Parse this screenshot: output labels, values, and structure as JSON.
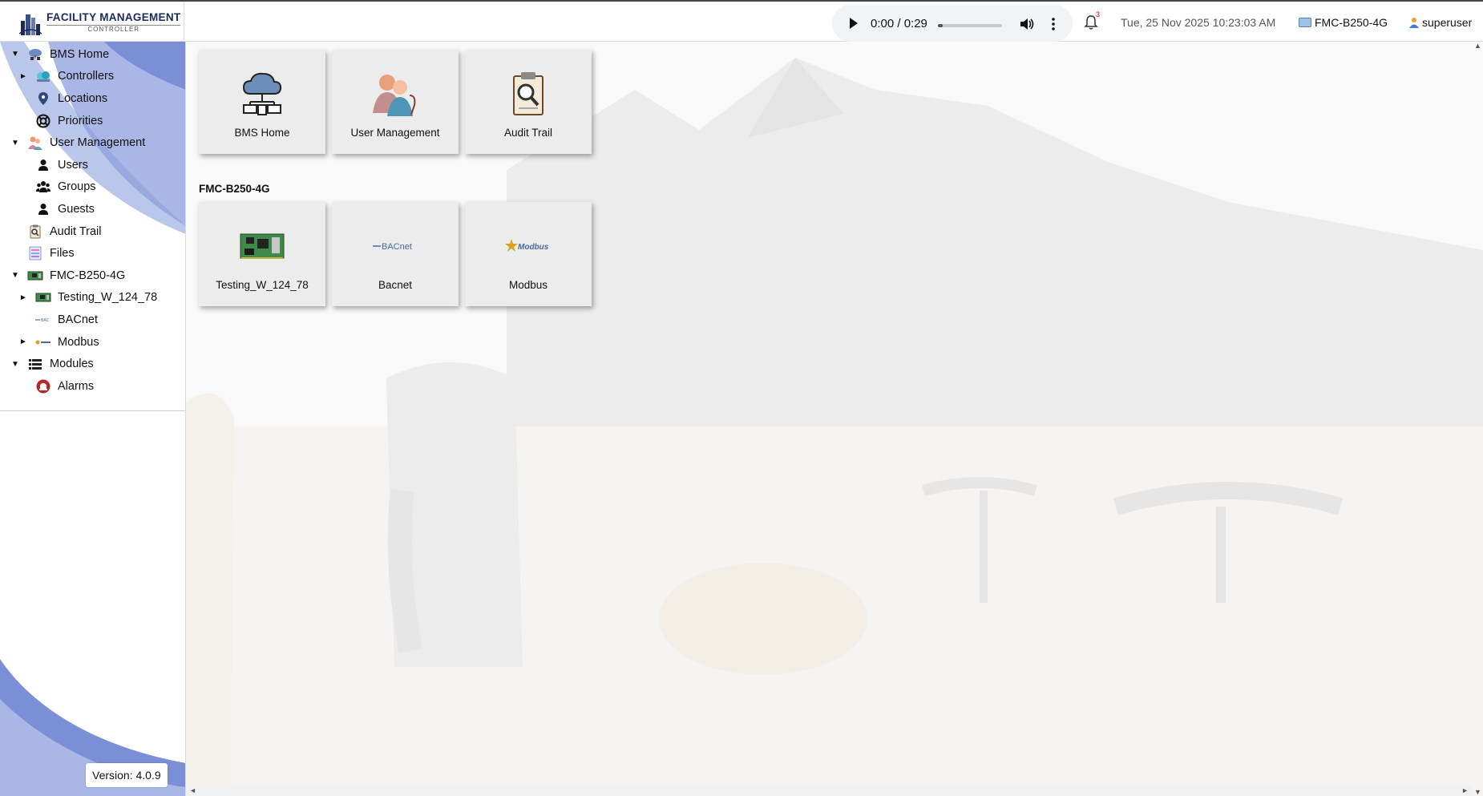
{
  "app": {
    "logo_main": "FACILITY MANAGEMENT",
    "logo_sub": "CONTROLLER"
  },
  "header": {
    "audio_time": "0:00 / 0:29",
    "audio_progress": 0.05,
    "notification_count": "3",
    "datetime": "Tue, 25 Nov 2025 10:23:03 AM",
    "controller": "FMC-B250-4G",
    "user": "superuser"
  },
  "sidebar": {
    "items": [
      {
        "label": "BMS Home",
        "caret": "▼",
        "level": 0,
        "icon": "cloud-network-icon"
      },
      {
        "label": "Controllers",
        "caret": "►",
        "level": 1,
        "icon": "controllers-icon"
      },
      {
        "label": "Locations",
        "caret": "",
        "level": 1,
        "icon": "location-pin-icon"
      },
      {
        "label": "Priorities",
        "caret": "",
        "level": 1,
        "icon": "lifebuoy-icon"
      },
      {
        "label": "User Management",
        "caret": "▼",
        "level": 0,
        "icon": "users-group-icon"
      },
      {
        "label": "Users",
        "caret": "",
        "level": 1,
        "icon": "user-icon"
      },
      {
        "label": "Groups",
        "caret": "",
        "level": 1,
        "icon": "group-icon"
      },
      {
        "label": "Guests",
        "caret": "",
        "level": 1,
        "icon": "guest-icon"
      },
      {
        "label": "Audit Trail",
        "caret": "",
        "level": 0,
        "icon": "audit-clipboard-icon"
      },
      {
        "label": "Files",
        "caret": "",
        "level": 0,
        "icon": "files-icon"
      },
      {
        "label": "FMC-B250-4G",
        "caret": "▼",
        "level": 0,
        "icon": "circuit-board-icon"
      },
      {
        "label": "Testing_W_124_78",
        "caret": "►",
        "level": 1,
        "icon": "circuit-board-icon"
      },
      {
        "label": "BACnet",
        "caret": "",
        "level": 1,
        "icon": "bacnet-icon"
      },
      {
        "label": "Modbus",
        "caret": "►",
        "level": 1,
        "icon": "modbus-icon"
      },
      {
        "label": "Modules",
        "caret": "▼",
        "level": 0,
        "icon": "modules-list-icon"
      },
      {
        "label": "Alarms",
        "caret": "",
        "level": 1,
        "icon": "alarm-icon"
      }
    ],
    "version": "Version: 4.0.9"
  },
  "main": {
    "tiles_top": [
      {
        "label": "BMS Home",
        "icon": "cloud-network-icon"
      },
      {
        "label": "User Management",
        "icon": "users-group-icon"
      },
      {
        "label": "Audit Trail",
        "icon": "audit-clipboard-icon"
      }
    ],
    "section_title": "FMC-B250-4G",
    "tiles_controller": [
      {
        "label": "Testing_W_124_78",
        "icon": "circuit-board-icon"
      },
      {
        "label": "Bacnet",
        "icon": "bacnet-logo-icon",
        "logo_text": "BACnet"
      },
      {
        "label": "Modbus",
        "icon": "modbus-logo-icon",
        "logo_text": "Modbus"
      }
    ]
  },
  "colors": {
    "sidebar_swoosh": "#7b8fd6",
    "sidebar_swoosh_light": "#a9b6e6",
    "brand_navy": "#1c2a5a",
    "tile_bg": "#ececec"
  }
}
